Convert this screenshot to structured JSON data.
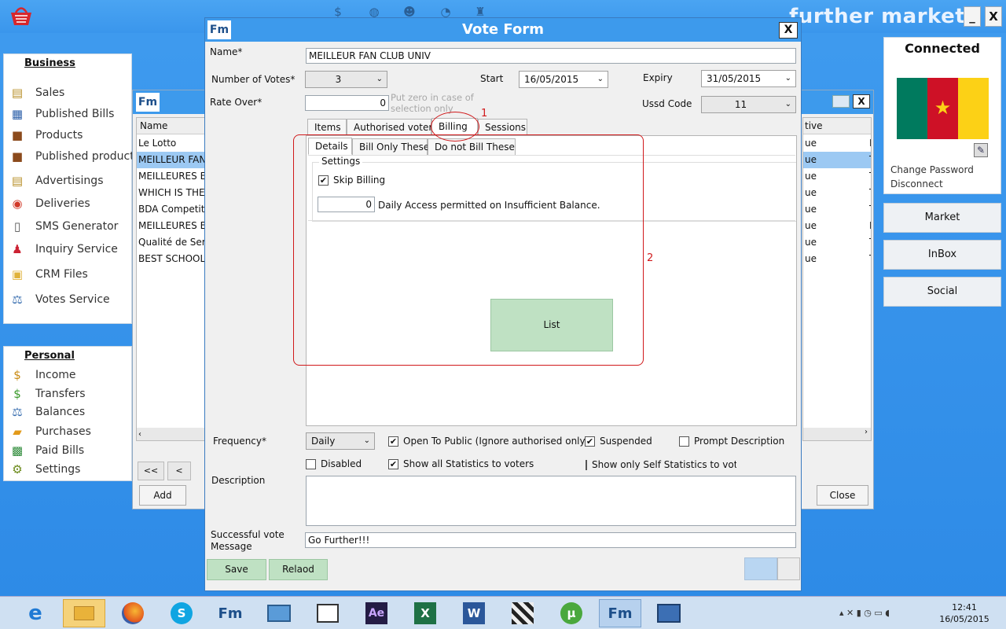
{
  "topbar": {
    "brand": "further market",
    "icons": [
      "sales-nav-icon",
      "globe-nav-icon",
      "users-nav-icon",
      "chart-nav-icon",
      "tower-nav-icon"
    ],
    "minimize_label": "_",
    "close_label": "X"
  },
  "business": {
    "title": "Business",
    "items": [
      {
        "label": "Sales",
        "icon": "clipboard-icon"
      },
      {
        "label": "Published Bills",
        "icon": "bill-icon"
      },
      {
        "label": "Products",
        "icon": "box-icon"
      },
      {
        "label": "Published products",
        "icon": "box-icon"
      },
      {
        "label": "Advertisings",
        "icon": "clipboard-icon"
      },
      {
        "label": "Deliveries",
        "icon": "delivery-icon"
      },
      {
        "label": "SMS Generator",
        "icon": "phone-icon"
      },
      {
        "label": "Inquiry Service",
        "icon": "person-icon"
      },
      {
        "label": "CRM Files",
        "icon": "folder-icon"
      },
      {
        "label": "Votes Service",
        "icon": "scale-icon"
      }
    ]
  },
  "personal": {
    "title": "Personal",
    "items": [
      {
        "label": "Income",
        "icon": "dollar-icon"
      },
      {
        "label": "Transfers",
        "icon": "transfer-icon"
      },
      {
        "label": "Balances",
        "icon": "scale-icon"
      },
      {
        "label": "Purchases",
        "icon": "basket-icon"
      },
      {
        "label": "Paid Bills",
        "icon": "money-icon"
      },
      {
        "label": "Settings",
        "icon": "gear-icon"
      }
    ]
  },
  "connected": {
    "title": "Connected",
    "change_password": "Change Password",
    "disconnect": "Disconnect",
    "flag_colors": [
      "#007a5e",
      "#ce1126",
      "#fcd116"
    ],
    "star": "★"
  },
  "right_buttons": [
    "Market",
    "InBox",
    "Social"
  ],
  "back_window": {
    "col_name": "Name",
    "col_active": "tive",
    "rows": [
      {
        "name": "Le Lotto",
        "active": "ue",
        "extra": "F"
      },
      {
        "name": "MEILLEUR FAN CLUB UNIV",
        "active": "ue",
        "extra": "T"
      },
      {
        "name": "MEILLEURES ECOLES",
        "active": "ue",
        "extra": "T"
      },
      {
        "name": "WHICH IS THE BEST",
        "active": "ue",
        "extra": "T"
      },
      {
        "name": "BDA Competition",
        "active": "ue",
        "extra": "T"
      },
      {
        "name": "MEILLEURES ECOLES",
        "active": "ue",
        "extra": "F"
      },
      {
        "name": "Qualité de Service",
        "active": "ue",
        "extra": "T"
      },
      {
        "name": "BEST SCHOOLS",
        "active": "ue",
        "extra": "T"
      }
    ],
    "nav_first": "<<",
    "nav_prev": "<",
    "add_label": "Add",
    "close_label": "Close",
    "close_x": "X"
  },
  "vote_form": {
    "title": "Vote Form",
    "close_x": "X",
    "name_label": "Name*",
    "name_value": "MEILLEUR FAN CLUB UNIV",
    "votes_label": "Number of Votes*",
    "votes_value": "3",
    "start_label": "Start",
    "start_value": "16/05/2015",
    "expiry_label": "Expiry",
    "expiry_value": "31/05/2015",
    "rate_label": "Rate Over*",
    "rate_value": "0",
    "rate_hint": "Put zero in case of selection only",
    "ussd_label": "Ussd Code",
    "ussd_value": "11",
    "tabs": [
      "Items",
      "Authorised voters",
      "Billing",
      "Sessions"
    ],
    "subtabs": [
      "Details",
      "Bill Only These",
      "Do not Bill These"
    ],
    "settings_legend": "Settings",
    "skip_billing_label": "Skip Billing",
    "skip_billing_checked": true,
    "daily_access_value": "0",
    "daily_access_label": "Daily Access permitted on Insufficient Balance.",
    "list_button": "List",
    "annotation_1": "1",
    "annotation_2": "2",
    "frequency_label": "Frequency*",
    "frequency_value": "Daily",
    "open_public_label": "Open To Public (Ignore authorised only)",
    "suspended_label": "Suspended",
    "prompt_description_label": "Prompt Description",
    "disabled_label": "Disabled",
    "show_all_stats_label": "Show all Statistics to voters",
    "show_self_stats_label": "Show only Self Statistics to voter:",
    "description_label": "Description",
    "success_label_1": "Successful vote",
    "success_label_2": "Message",
    "success_value": "Go Further!!!",
    "save_label": "Save",
    "reload_label": "Relaod",
    "check_mark": "✔"
  },
  "taskbar": {
    "apps": [
      "ie-icon",
      "explorer-icon",
      "firefox-icon",
      "skype-icon",
      "fm-app-icon",
      "control-panel-icon",
      "notepad-icon",
      "after-effects-icon",
      "excel-icon",
      "word-icon",
      "clapper-icon",
      "utorrent-icon",
      "fm-app-icon-2",
      "remote-icon"
    ],
    "labels": {
      "ae": "Ae",
      "x": "X",
      "w": "W",
      "fm": "Fm",
      "s": "S",
      "u": "µ",
      "e": "e"
    },
    "time": "12:41",
    "date": "16/05/2015"
  }
}
